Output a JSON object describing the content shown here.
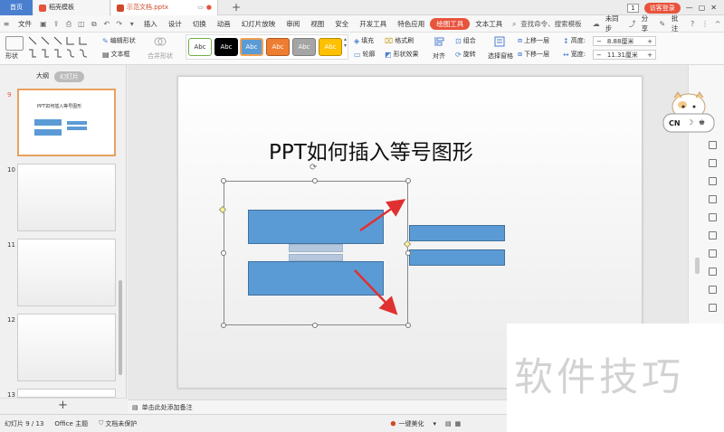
{
  "tabs": {
    "home": "首页",
    "template": "稻壳模板",
    "file": "示范文档.pptx",
    "page_num": "1",
    "login": "访客登录"
  },
  "menu": {
    "file": "文件",
    "items": [
      "插入",
      "设计",
      "切换",
      "动画",
      "幻灯片放映",
      "审阅",
      "视图",
      "安全",
      "开发工具",
      "特色应用"
    ],
    "active": "绘图工具",
    "text_tool": "文本工具",
    "search": "查找命令、搜索模板",
    "sync": "未同步",
    "share": "分享",
    "comment": "批注"
  },
  "ribbon": {
    "shape": "形状",
    "edit_shape": "编辑形状",
    "textbox": "文本框",
    "merge_shape": "合并形状",
    "styles": [
      {
        "label": "Abc",
        "bg": "#ffffff",
        "fg": "#333333",
        "border": "#70ad47"
      },
      {
        "label": "Abc",
        "bg": "#000000",
        "fg": "#ffffff",
        "border": "#000000"
      },
      {
        "label": "Abc",
        "bg": "#5b9bd5",
        "fg": "#ffffff",
        "border": "#41719c"
      },
      {
        "label": "Abc",
        "bg": "#ed7d31",
        "fg": "#ffffff",
        "border": "#ae5a21"
      },
      {
        "label": "Abc",
        "bg": "#a5a5a5",
        "fg": "#ffffff",
        "border": "#7f7f7f"
      },
      {
        "label": "Abc",
        "bg": "#ffc000",
        "fg": "#ffffff",
        "border": "#bc8c00"
      }
    ],
    "fill": "填充",
    "format_painter": "格式刷",
    "outline": "轮廓",
    "shape_effect": "形状效果",
    "align": "对齐",
    "group": "组合",
    "rotate": "旋转",
    "selection_pane": "选择窗格",
    "bring_forward": "上移一层",
    "send_backward": "下移一层",
    "height_label": "高度:",
    "height_value": "8.88厘米",
    "width_label": "宽度:",
    "width_value": "11.31厘米"
  },
  "left_pane": {
    "outline_tab": "大纲",
    "slides_tab": "幻灯片",
    "slides": [
      {
        "num": "9",
        "title": "PPT如何插入等号图形",
        "selected": true
      },
      {
        "num": "10"
      },
      {
        "num": "11"
      },
      {
        "num": "12"
      },
      {
        "num": "13"
      }
    ]
  },
  "slide": {
    "title": "PPT如何插入等号图形"
  },
  "notes": {
    "placeholder": "单击此处添加备注"
  },
  "status": {
    "slide_info": "幻灯片 9 / 13",
    "theme": "Office 主题",
    "protection": "文档未保护",
    "beautify": "一键美化"
  },
  "cat": {
    "cn": "CN"
  },
  "watermark": "软件技巧"
}
